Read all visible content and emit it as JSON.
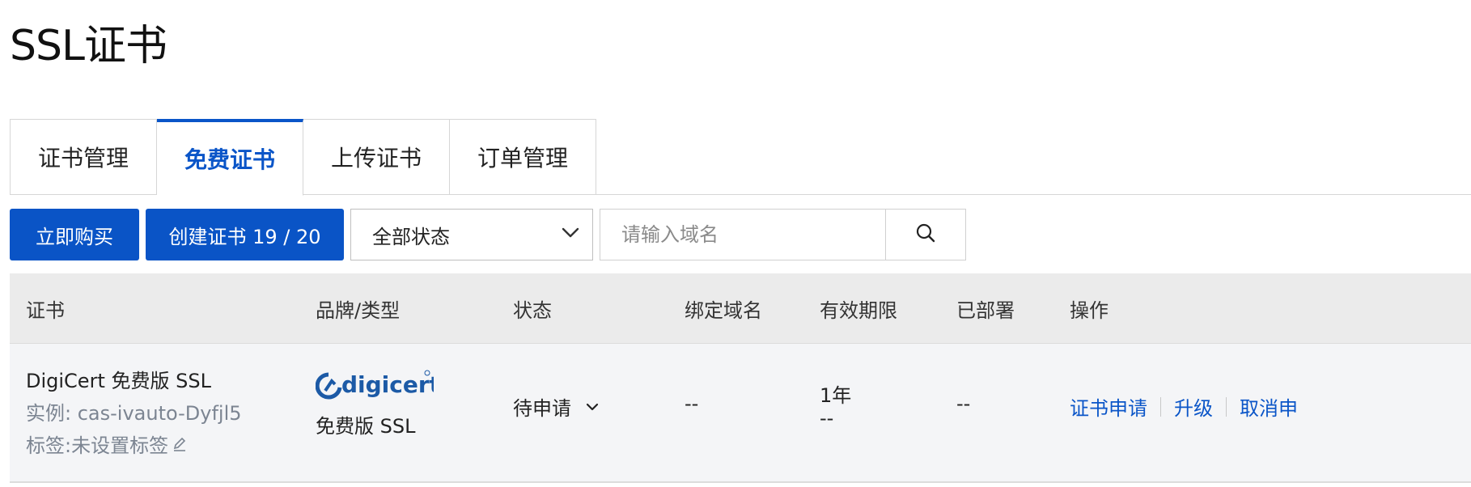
{
  "page": {
    "title": "SSL证书"
  },
  "tabs": [
    {
      "label": "证书管理",
      "active": false
    },
    {
      "label": "免费证书",
      "active": true
    },
    {
      "label": "上传证书",
      "active": false
    },
    {
      "label": "订单管理",
      "active": false
    }
  ],
  "toolbar": {
    "buy_label": "立即购买",
    "create_label": "创建证书 19 / 20",
    "status_select": {
      "value": "全部状态"
    },
    "search": {
      "placeholder": "请输入域名"
    }
  },
  "table": {
    "headers": [
      "证书",
      "品牌/类型",
      "状态",
      "绑定域名",
      "有效期限",
      "已部署",
      "操作"
    ],
    "rows": [
      {
        "name": "DigiCert 免费版 SSL",
        "instance": "实例: cas-ivauto-Dyfjl5",
        "tag": "标签:未设置标签",
        "brand_logo": "digicert",
        "brand_type": "免费版 SSL",
        "status": "待申请",
        "domain": "--",
        "validity_term": "1年",
        "validity_date": "--",
        "deployed": "--",
        "actions": [
          "证书申请",
          "升级",
          "取消申"
        ]
      }
    ]
  },
  "colors": {
    "accent": "#0a55c8",
    "header_bg": "#ebebeb",
    "row_bg": "#f4f5f7"
  },
  "icons": {
    "select_arrow": "chevron-down-icon",
    "search": "search-icon",
    "edit": "edit-icon",
    "status_arrow": "chevron-down-icon"
  }
}
